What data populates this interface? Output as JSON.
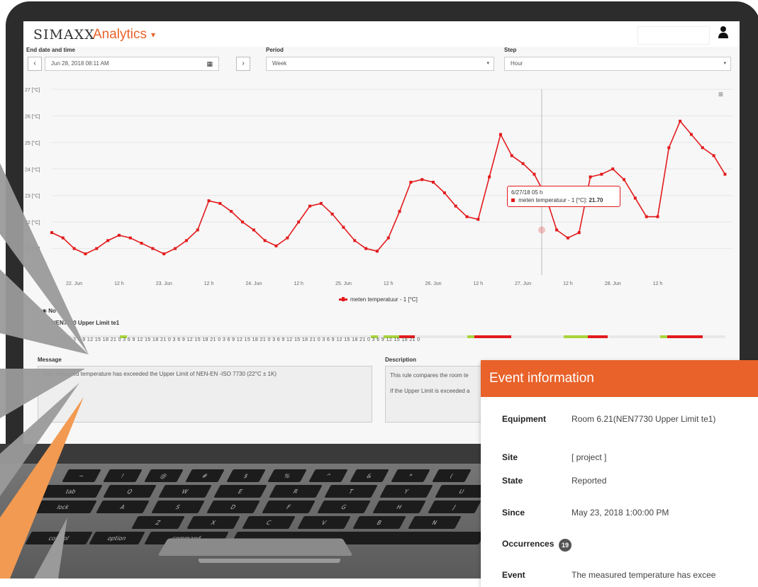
{
  "app": {
    "logo_text": "SIMAXX",
    "title": "Analytics",
    "caret": "▾",
    "user_icon": "user-icon"
  },
  "controls": {
    "end_date_label": "End date and time",
    "end_date_value": "Jun 28, 2018 08:11 AM",
    "prev_button": "‹",
    "next_button": "›",
    "calendar_icon": "calendar-icon",
    "period_label": "Period",
    "period_value": "Week",
    "step_label": "Step",
    "step_value": "Hour"
  },
  "colors": {
    "accent": "#e8622a",
    "series": "#e31a1c",
    "green": "#a8d43b",
    "red": "#e31a1c"
  },
  "chart_data": {
    "type": "line",
    "title": "",
    "xlabel": "",
    "ylabel": "",
    "ylim": [
      20,
      27
    ],
    "y_ticks": [
      "27 [°C]",
      "26 [°C]",
      "25 [°C]",
      "24 [°C]",
      "23 [°C]",
      "22 [°C]",
      "21 [°C]"
    ],
    "x_ticks": [
      "22. Jun",
      "12 h",
      "23. Jun",
      "12 h",
      "24. Jun",
      "12 h",
      "25. Jun",
      "12 h",
      "26. Jun",
      "12 h",
      "27. Jun",
      "12 h",
      "28. Jun",
      "12 h"
    ],
    "x_tick_hours": [
      0,
      12,
      24,
      36,
      48,
      60,
      72,
      84,
      96,
      108,
      120,
      132,
      144,
      156
    ],
    "x_range_hours": [
      -6,
      176
    ],
    "series": [
      {
        "name": "meten temperatuur - 1 [°C]",
        "hours": [
          -6,
          -3,
          0,
          3,
          6,
          9,
          12,
          15,
          18,
          21,
          24,
          27,
          30,
          33,
          36,
          39,
          42,
          45,
          48,
          51,
          54,
          57,
          60,
          63,
          66,
          69,
          72,
          75,
          78,
          81,
          84,
          87,
          90,
          93,
          96,
          99,
          102,
          105,
          108,
          111,
          114,
          117,
          120,
          123,
          126,
          129,
          132,
          135,
          138,
          141,
          144,
          147,
          150,
          153,
          156,
          159,
          162,
          165,
          168,
          171,
          174
        ],
        "values": [
          21.6,
          21.4,
          21.0,
          20.8,
          21.0,
          21.3,
          21.5,
          21.4,
          21.2,
          21.0,
          20.8,
          21.0,
          21.3,
          21.7,
          22.8,
          22.7,
          22.4,
          22.0,
          21.7,
          21.3,
          21.1,
          21.4,
          22.0,
          22.6,
          22.7,
          22.3,
          21.8,
          21.3,
          21.0,
          20.9,
          21.4,
          22.4,
          23.5,
          23.6,
          23.5,
          23.1,
          22.6,
          22.2,
          22.1,
          23.7,
          25.3,
          24.5,
          24.2,
          23.8,
          23.0,
          21.7,
          21.4,
          21.6,
          23.7,
          23.8,
          24.0,
          23.6,
          22.9,
          22.2,
          22.2,
          24.8,
          25.8,
          25.3,
          24.8,
          24.5,
          23.8
        ]
      }
    ],
    "legend": [
      "meten temperatuur - 1 [°C]"
    ],
    "legend_position": "bottom-center",
    "grid": true
  },
  "tooltip": {
    "line1": "6/27/18 05 h",
    "line2_label": "meten temperatuur - 1 [°C]:",
    "line2_value": "21.70"
  },
  "rule": {
    "radio_label": "No",
    "name": "NEN7730 Upper Limit te1",
    "timeline_ticks": "3  6  9  12  15  18  21  0  3  6  9  12  15  18  21  0  3  6  9  12  15  18  21  0  3  6  9  12  15  18  21  0  3  6  9  12  15  18  21  0  3  6  9  12  15  18  21  0  3  6  9  12  15  18  21  0"
  },
  "message": {
    "label": "Message",
    "text": "The measured temperature has exceeded the Upper Limit of NEN-EN -ISO 7730 (22°C ± 1K)"
  },
  "description": {
    "label": "Description",
    "line1": "This rule compares the room te",
    "line2": "If the Upper Limit is exceeded a"
  },
  "event": {
    "header": "Event information",
    "rows": [
      {
        "key": "Equipment",
        "value": "Room 6.21(NEN7730 Upper Limit te1)"
      },
      {
        "key": "Site",
        "value": "[ project ]"
      },
      {
        "key": "State",
        "value": "Reported"
      },
      {
        "key": "Since",
        "value": "May 23, 2018 1:00:00 PM"
      },
      {
        "key": "Occurrences",
        "value": "19"
      },
      {
        "key": "Event",
        "value": "The measured temperature has excee"
      }
    ]
  },
  "keyboard": {
    "row1": [
      "~",
      "!",
      "@",
      "#",
      "$",
      "%",
      "^",
      "&",
      "*",
      "("
    ],
    "row2": [
      "Q",
      "W",
      "E",
      "R",
      "T",
      "Y",
      "U"
    ],
    "row3": [
      "A",
      "S",
      "D",
      "F",
      "G",
      "H",
      "J"
    ],
    "row4": [
      "Z",
      "X",
      "C",
      "V",
      "B",
      "N"
    ],
    "row5": [
      "control",
      "option",
      "command"
    ],
    "left_labels": [
      "tab",
      "lock"
    ]
  }
}
